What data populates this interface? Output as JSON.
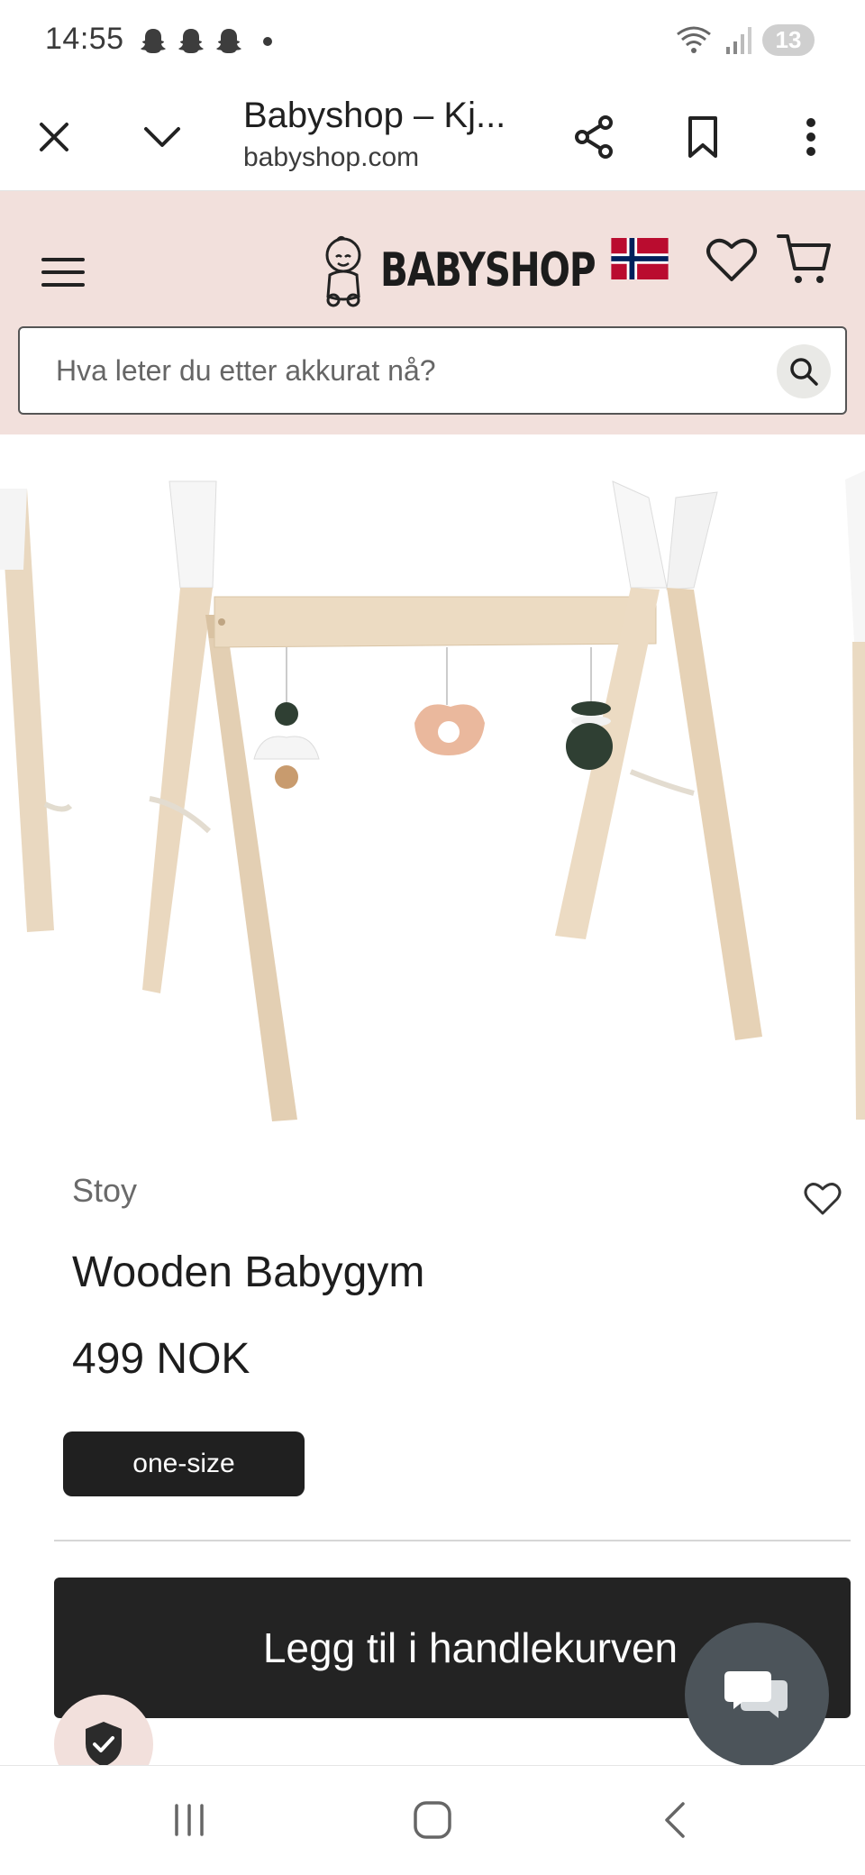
{
  "status": {
    "time": "14:55",
    "notification_icons": [
      "snapchat-icon",
      "snapchat-icon",
      "snapchat-icon"
    ],
    "battery": "13"
  },
  "browser": {
    "title": "Babyshop – Kj...",
    "url": "babyshop.com",
    "close_icon": "close-icon",
    "collapse_icon": "chevron-down-icon",
    "share_icon": "share-icon",
    "bookmark_icon": "bookmark-icon",
    "menu_icon": "more-vert-icon"
  },
  "header": {
    "logo_text": "BABYSHOP",
    "search_placeholder": "Hva leter du etter akkurat nå?",
    "colors": {
      "header_bg": "#f2e0dc",
      "accent_dark": "#232323"
    }
  },
  "product": {
    "brand": "Stoy",
    "name": "Wooden Babygym",
    "price": "499 NOK",
    "size": "one-size",
    "add_to_cart_label": "Legg til i handlekurven"
  },
  "nav": {
    "recent_icon": "recent-apps-icon",
    "home_icon": "home-icon",
    "back_icon": "back-icon"
  }
}
